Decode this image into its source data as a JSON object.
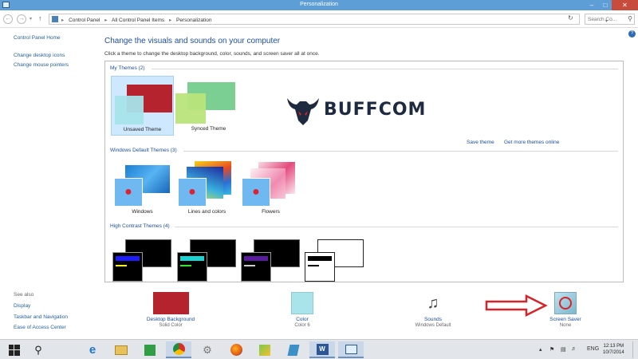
{
  "window": {
    "title": "Personalization"
  },
  "address": {
    "crumbs": [
      "Control Panel",
      "All Control Panel Items",
      "Personalization"
    ],
    "search_placeholder": "Search Co..."
  },
  "sidebar": {
    "home": "Control Panel Home",
    "links": [
      "Change desktop icons",
      "Change mouse pointers"
    ],
    "see_also_title": "See also",
    "see_also": [
      "Display",
      "Taskbar and Navigation",
      "Ease of Access Center"
    ]
  },
  "main": {
    "heading": "Change the visuals and sounds on your computer",
    "description": "Click a theme to change the desktop background, color, sounds, and screen saver all at once."
  },
  "themes": {
    "my_themes_label": "My Themes (2)",
    "my_themes": [
      {
        "name": "Unsaved Theme"
      },
      {
        "name": "Synced Theme"
      }
    ],
    "save_theme": "Save theme",
    "get_more": "Get more themes online",
    "default_label": "Windows Default Themes (3)",
    "default_themes": [
      {
        "name": "Windows"
      },
      {
        "name": "Lines and colors"
      },
      {
        "name": "Flowers"
      }
    ],
    "high_contrast_label": "High Contrast Themes (4)"
  },
  "bottom": [
    {
      "label": "Desktop Background",
      "sub": "Solid Color"
    },
    {
      "label": "Color",
      "sub": "Color 6"
    },
    {
      "label": "Sounds",
      "sub": "Windows Default"
    },
    {
      "label": "Screen Saver",
      "sub": "None"
    }
  ],
  "watermark": {
    "text": "BUFFCOM"
  },
  "taskbar": {
    "lang": "ENG",
    "time": "12:13 PM",
    "date": "10/7/2014"
  },
  "colors": {
    "accent_blue": "#1e4ea0",
    "desktop_bg": "#b5232e",
    "color_swatch": "#a8e4ea",
    "title_bar": "#5e9ed6",
    "close_red": "#c74c3c"
  }
}
